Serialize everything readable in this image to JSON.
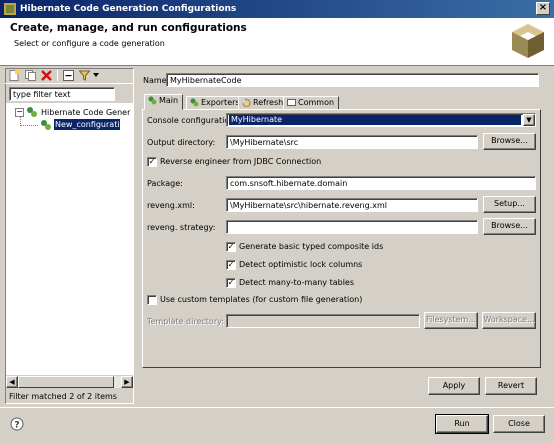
{
  "window": {
    "title": "Hibernate Code Generation Configurations"
  },
  "header": {
    "title": "Create, manage, and run configurations",
    "subtitle": "Select or configure a code generation"
  },
  "left": {
    "filter_placeholder": "type filter text",
    "tree": [
      {
        "label": "Hibernate Code Generation",
        "level": 0,
        "expanded": true
      },
      {
        "label": "New_configuration",
        "level": 1,
        "selected": true
      }
    ],
    "status": "Filter matched 2 of 2 items",
    "toolbar_icons": [
      "new-config-icon",
      "duplicate-config-icon",
      "delete-config-icon",
      "collapse-all-icon",
      "filter-icon"
    ]
  },
  "form": {
    "name_label": "Name:",
    "name_value": "MyHibernateCode",
    "tabs": [
      {
        "label": "Main",
        "icon": "main-tab-icon",
        "active": true
      },
      {
        "label": "Exporters",
        "icon": "exporters-tab-icon"
      },
      {
        "label": "Refresh",
        "icon": "refresh-tab-icon"
      },
      {
        "label": "Common",
        "icon": "common-tab-icon"
      }
    ],
    "console_config_label": "Console configuration:",
    "console_config_value": "MyHibernate",
    "output_dir_label": "Output directory:",
    "output_dir_value": "\\MyHibernate\\src",
    "browse_label": "Browse...",
    "reverse_engineer_label": "Reverse engineer from JDBC Connection",
    "reverse_engineer_checked": true,
    "package_label": "Package:",
    "package_value": "com.snsoft.hibernate.domain",
    "reveng_xml_label": "reveng.xml:",
    "reveng_xml_value": "\\MyHibernate\\src\\hibernate.reveng.xml",
    "setup_label": "Setup...",
    "reveng_strategy_label": "reveng. strategy:",
    "reveng_strategy_value": "",
    "options": [
      {
        "label": "Generate basic typed composite ids",
        "checked": true
      },
      {
        "label": "Detect optimistic lock columns",
        "checked": true
      },
      {
        "label": "Detect many-to-many tables",
        "checked": true
      }
    ],
    "custom_templates_label": "Use custom templates (for custom file generation)",
    "custom_templates_checked": false,
    "template_dir_label": "Template directory:",
    "template_dir_value": "",
    "filesystem_label": "Filesystem...",
    "workspace_label": "Workspace...",
    "apply_label": "Apply",
    "revert_label": "Revert"
  },
  "footer": {
    "run_label": "Run",
    "close_label": "Close"
  },
  "colors": {
    "title_start": "#0a246a",
    "title_end": "#3a6ea5",
    "selection": "#0a246a",
    "face": "#d4d0c8"
  }
}
